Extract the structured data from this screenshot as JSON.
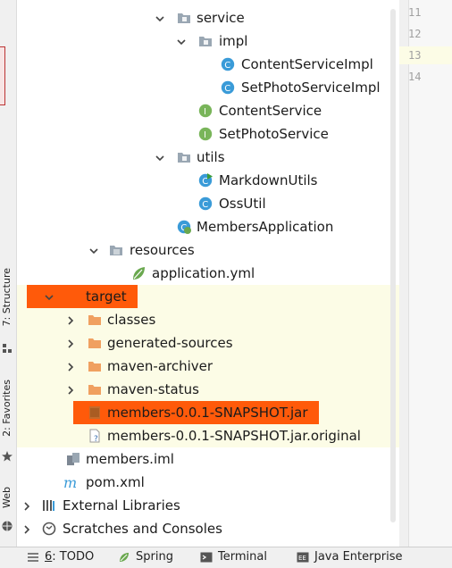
{
  "side_tabs": {
    "structure": "7: Structure",
    "favorites": "2: Favorites",
    "web": "Web"
  },
  "tree": [
    {
      "label": "service",
      "type": "package",
      "arrow": "down"
    },
    {
      "label": "impl",
      "type": "package",
      "arrow": "down"
    },
    {
      "label": "ContentServiceImpl",
      "type": "class"
    },
    {
      "label": "SetPhotoServiceImpl",
      "type": "class"
    },
    {
      "label": "ContentService",
      "type": "interface"
    },
    {
      "label": "SetPhotoService",
      "type": "interface"
    },
    {
      "label": "utils",
      "type": "package",
      "arrow": "down"
    },
    {
      "label": "MarkdownUtils",
      "type": "class-run"
    },
    {
      "label": "OssUtil",
      "type": "class"
    },
    {
      "label": "MembersApplication",
      "type": "spring-app"
    },
    {
      "label": "resources",
      "type": "resources",
      "arrow": "down"
    },
    {
      "label": "application.yml",
      "type": "yml"
    },
    {
      "label": "target",
      "type": "folder-open",
      "arrow": "down"
    },
    {
      "label": "classes",
      "type": "folder-orange",
      "arrow": "right"
    },
    {
      "label": "generated-sources",
      "type": "folder-orange",
      "arrow": "right"
    },
    {
      "label": "maven-archiver",
      "type": "folder-orange",
      "arrow": "right"
    },
    {
      "label": "maven-status",
      "type": "folder-orange",
      "arrow": "right"
    },
    {
      "label": "members-0.0.1-SNAPSHOT.jar",
      "type": "jar"
    },
    {
      "label": "members-0.0.1-SNAPSHOT.jar.original",
      "type": "unknown"
    },
    {
      "label": "members.iml",
      "type": "iml"
    },
    {
      "label": "pom.xml",
      "type": "maven"
    },
    {
      "label": "External Libraries",
      "type": "libraries",
      "arrow": "right"
    },
    {
      "label": "Scratches and Consoles",
      "type": "scratches",
      "arrow": "right"
    }
  ],
  "line_numbers": [
    "11",
    "12",
    "13",
    "14"
  ],
  "bottom_tabs": [
    {
      "prefix": "6",
      "label": ": TODO",
      "icon": "todo-icon"
    },
    {
      "prefix": "",
      "label": "Spring",
      "icon": "spring-icon"
    },
    {
      "prefix": "",
      "label": "Terminal",
      "icon": "terminal-icon"
    },
    {
      "prefix": "",
      "label": "Java Enterprise",
      "icon": "java-enterprise-icon"
    }
  ],
  "colors": {
    "highlight": "#ff5a0a",
    "selection": "#fcfce6",
    "folder_orange": "#f0a060",
    "class_blue": "#3a9bd8",
    "interface_green": "#79b55a"
  }
}
